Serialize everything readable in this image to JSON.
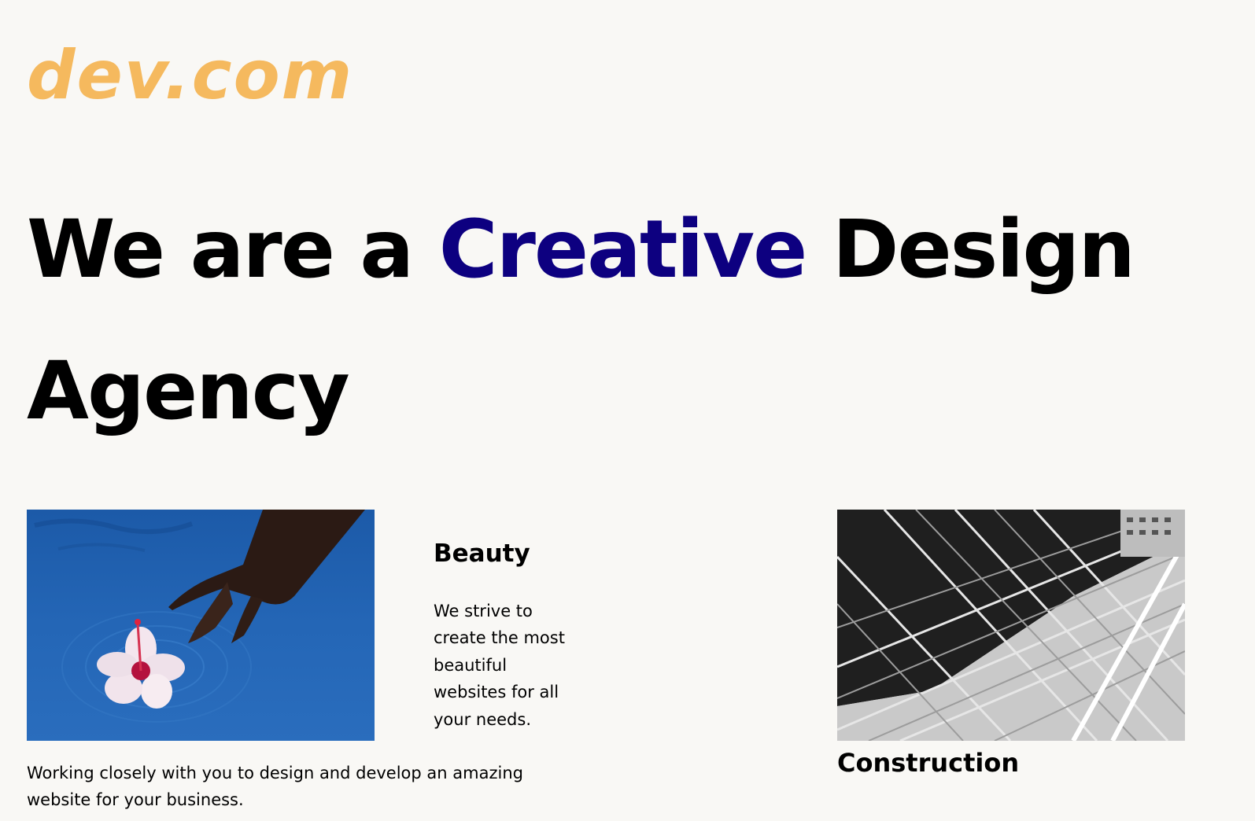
{
  "header": {
    "logo_text": "dev.com"
  },
  "hero": {
    "title_before": "We are a ",
    "title_accent": "Creative",
    "title_after": " Design Agency",
    "accent_color": "#0d0080"
  },
  "brand_color": "#f5b95e",
  "cards": [
    {
      "title": "Beauty",
      "description": "We strive to create the most beautiful websites for all your needs.",
      "image_icon": "hibiscus-flower-in-water-photo"
    },
    {
      "title": "Construction",
      "image_icon": "steel-structure-photo"
    }
  ],
  "intro": {
    "text": "Working closely with you to design and develop an amazing website for your business."
  }
}
